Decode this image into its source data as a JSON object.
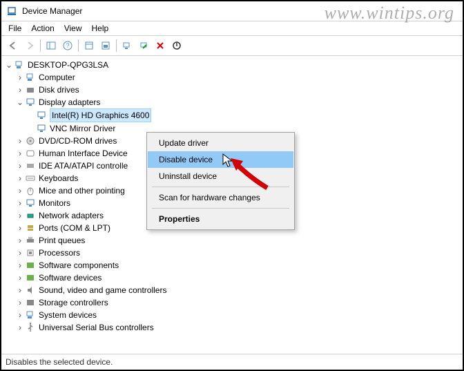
{
  "watermark": "www.wintips.org",
  "window": {
    "title": "Device Manager"
  },
  "menu": {
    "file": "File",
    "action": "Action",
    "view": "View",
    "help": "Help"
  },
  "tree": {
    "root": "DESKTOP-QPG3LSA",
    "items": [
      "Computer",
      "Disk drives",
      "Display adapters",
      "Intel(R) HD Graphics 4600",
      "VNC Mirror Driver",
      "DVD/CD-ROM drives",
      "Human Interface Device",
      "IDE ATA/ATAPI controlle",
      "Keyboards",
      "Mice and other pointing",
      "Monitors",
      "Network adapters",
      "Ports (COM & LPT)",
      "Print queues",
      "Processors",
      "Software components",
      "Software devices",
      "Sound, video and game controllers",
      "Storage controllers",
      "System devices",
      "Universal Serial Bus controllers"
    ]
  },
  "context": {
    "update": "Update driver",
    "disable": "Disable device",
    "uninstall": "Uninstall device",
    "scan": "Scan for hardware changes",
    "properties": "Properties"
  },
  "status": "Disables the selected device."
}
